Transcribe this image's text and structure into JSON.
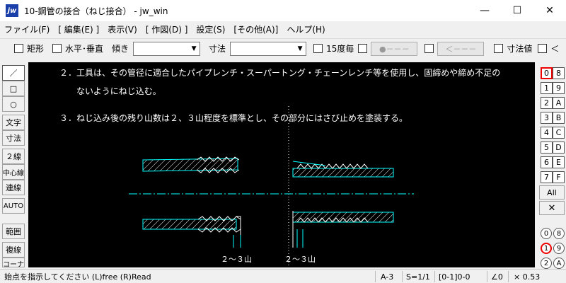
{
  "window": {
    "icon_text": "jw",
    "title": "10-鋼管の接合（ねじ接合） - jw_win",
    "minimize": "—",
    "maximize": "☐",
    "close": "✕"
  },
  "menu": [
    "ファイル(F)",
    "[ 編集(E) ]",
    "表示(V)",
    "[ 作図(D) ]",
    "設定(S)",
    "[その他(A)]",
    "ヘルプ(H)"
  ],
  "toolbar": {
    "rect_label": "矩形",
    "horiz_vert_label": "水平･垂直",
    "slope_label": "傾き",
    "slope_value": "",
    "dim_label": "寸法",
    "dim_value": "",
    "deg15_label": "15度毎",
    "btn_dot": "●－－－",
    "btn_arrow": "＜－－－",
    "dim_value_label": "寸法値",
    "lt_label": "＜"
  },
  "left_tools": [
    "／",
    "□",
    "○",
    "文字",
    "寸法",
    "２線",
    "中心線",
    "連線",
    "AUTO",
    "範囲",
    "複線",
    "コーナー"
  ],
  "canvas": {
    "line1": "２．工具は、その管径に適合したパイプレンチ・スーパートング・チェーンレンチ等を使用し、固締めや締め不足の",
    "line2": "ないようにねじ込む。",
    "line3": "３．ねじ込み後の残り山数は２、３山程度を標準とし、その部分にはさび止めを塗装する。",
    "label_left": "２～３山",
    "label_right": "２～３山",
    "colors": {
      "cyan": "#00ffff",
      "white": "#ffffff",
      "background": "#000000"
    }
  },
  "layers": {
    "left": [
      "0",
      "1",
      "2",
      "3",
      "4",
      "5",
      "6",
      "7"
    ],
    "right": [
      "8",
      "9",
      "A",
      "B",
      "C",
      "D",
      "E",
      "F"
    ],
    "active": "0",
    "all_label": "All",
    "x_label": "✕",
    "group_left": [
      "0",
      "1",
      "2"
    ],
    "group_right": [
      "8",
      "9",
      "A"
    ],
    "active_group": "1"
  },
  "status": {
    "message": "始点を指示してください (L)free (R)Read",
    "paper": "A-3",
    "scale": "S=1/1",
    "layer": "[0-1]0-0",
    "angle": "∠0",
    "zoom": "× 0.53"
  }
}
